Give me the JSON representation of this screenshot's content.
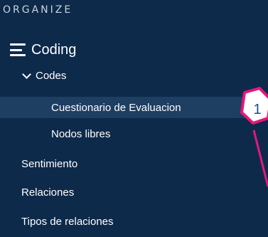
{
  "sidebar": {
    "section_header": "ORGANIZE",
    "top_item": {
      "label": "Coding",
      "icon": "menu-lines-icon"
    },
    "items": [
      {
        "label": "Codes",
        "icon": "chevron-down-icon",
        "expanded": true
      },
      {
        "label": "Cuestionario de Evaluacion",
        "selected": true
      },
      {
        "label": "Nodos libres"
      },
      {
        "label": "Sentimiento"
      },
      {
        "label": "Relaciones"
      },
      {
        "label": "Tipos de relaciones"
      }
    ]
  },
  "callout": {
    "number": "1",
    "border_color": "#e5177b",
    "fill_color": "#ffffff",
    "text_color": "#1a4f8b"
  },
  "colors": {
    "background": "#0d2a4a",
    "selected_row": "#1e3e62",
    "text": "#ffffff"
  }
}
